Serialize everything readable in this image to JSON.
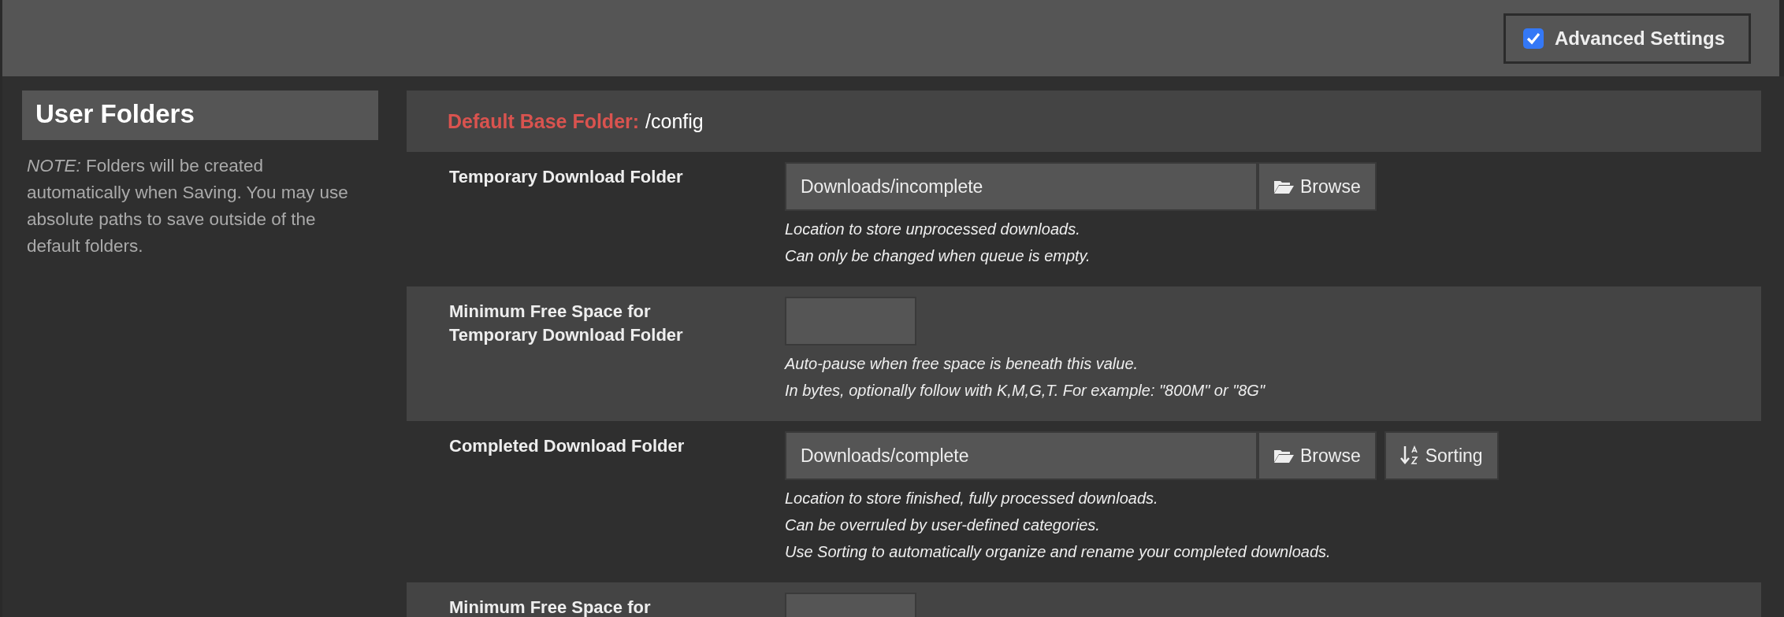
{
  "header": {
    "advanced_settings": {
      "label": "Advanced Settings",
      "checked": true
    }
  },
  "sidebar": {
    "title": "User Folders",
    "note": "*NOTE:* Folders will be created automatically when Saving. You may use absolute paths to save outside of the default folders."
  },
  "panel": {
    "base_folder": {
      "label": "Default Base Folder:",
      "value": "/config"
    },
    "rows": [
      {
        "label": "Temporary Download Folder",
        "field": {
          "kind": "path",
          "value": "Downloads/incomplete"
        },
        "buttons": [
          {
            "kind": "browse",
            "label": "Browse"
          }
        ],
        "hints": [
          "Location to store unprocessed downloads.",
          "Can only be changed when queue is empty."
        ]
      },
      {
        "label": "Minimum Free Space for Temporary Download Folder",
        "field": {
          "kind": "size"
        },
        "buttons": [],
        "hints": [
          "Auto-pause when free space is beneath this value.",
          "In bytes, optionally follow with K,M,G,T. For example: \"800M\" or \"8G\""
        ]
      },
      {
        "label": "Completed Download Folder",
        "field": {
          "kind": "path",
          "value": "Downloads/complete"
        },
        "buttons": [
          {
            "kind": "browse",
            "label": "Browse"
          },
          {
            "kind": "sorting",
            "label": "Sorting"
          }
        ],
        "hints": [
          "Location to store finished, fully processed downloads.",
          "Can be overruled by user-defined categories.",
          "Use Sorting to automatically organize and rename your completed downloads."
        ]
      },
      {
        "label": "Minimum Free Space for",
        "field": {
          "kind": "size"
        },
        "buttons": [],
        "hints": []
      }
    ]
  }
}
